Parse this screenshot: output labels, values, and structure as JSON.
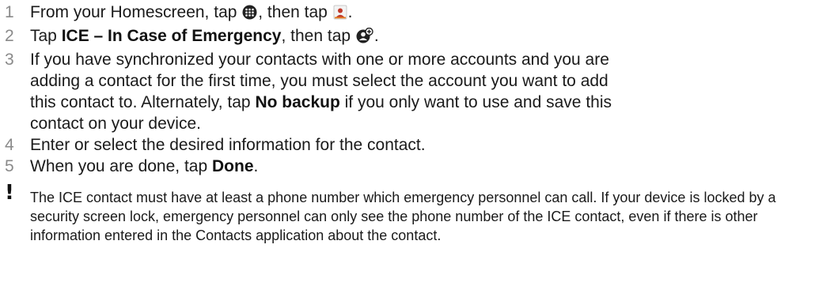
{
  "steps": [
    {
      "number": "1",
      "parts": {
        "a": "From your Homescreen, tap ",
        "b": ", then tap ",
        "c": "."
      },
      "icons": [
        "apps-grid-icon",
        "contacts-app-icon"
      ]
    },
    {
      "number": "2",
      "parts": {
        "a": "Tap ",
        "bold": "ICE – In Case of Emergency",
        "b": ", then tap ",
        "c": "."
      },
      "icons": [
        "add-contact-icon"
      ]
    },
    {
      "number": "3",
      "parts": {
        "a": "If you have synchronized your contacts with one or more accounts and you are adding a contact for the first time, you must select the account you want to add this contact to. Alternately, tap ",
        "bold": "No backup",
        "b": " if you only want to use and save this contact on your device."
      }
    },
    {
      "number": "4",
      "parts": {
        "a": "Enter or select the desired information for the contact."
      }
    },
    {
      "number": "5",
      "parts": {
        "a": "When you are done, tap ",
        "bold": "Done",
        "b": "."
      }
    }
  ],
  "note": {
    "icon": "exclamation-icon",
    "symbol": "!",
    "text": "The ICE contact must have at least a phone number which emergency personnel can call. If your device is locked by a security screen lock, emergency personnel can only see the phone number of the ICE contact, even if there is other information entered in the Contacts application about the contact."
  }
}
